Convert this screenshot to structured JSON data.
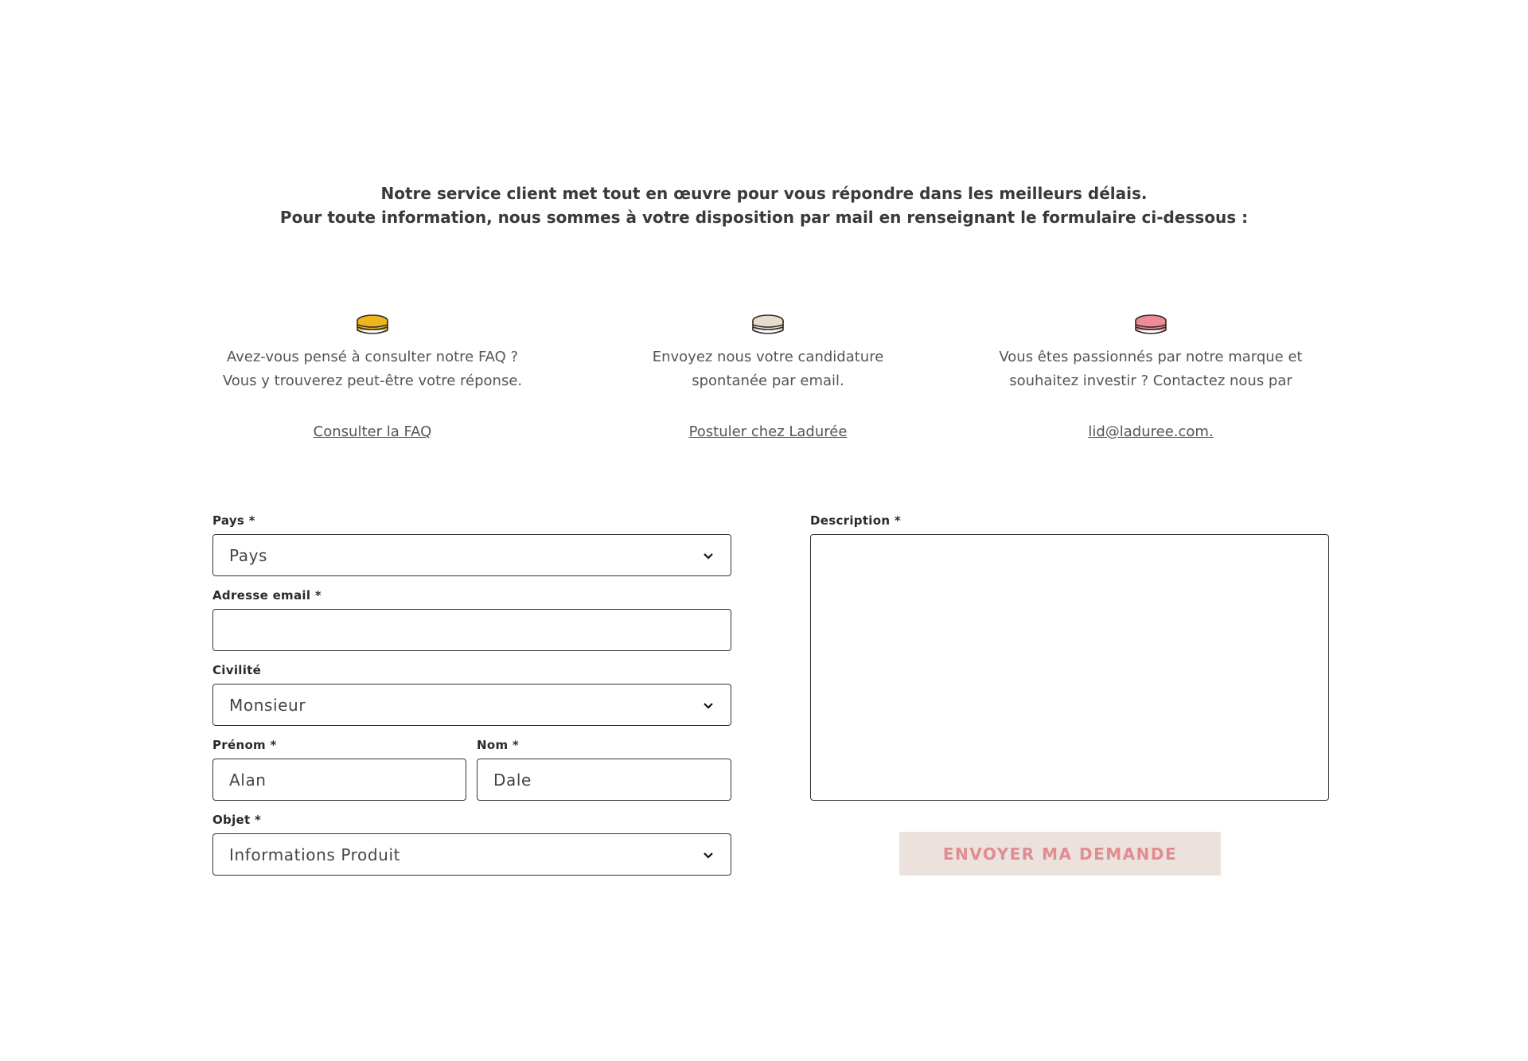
{
  "intro": {
    "line1": "Notre service client met tout en œuvre pour vous répondre dans les meilleurs délais.",
    "line2": "Pour toute information, nous sommes à votre disposition par mail en renseignant le formulaire ci-dessous :"
  },
  "info_columns": [
    {
      "icon": "macaron-yellow-icon",
      "color": "#f0b41c",
      "line1": "Avez-vous pensé à consulter notre FAQ ?",
      "line2": "Vous y trouverez peut-être votre réponse.",
      "link": "Consulter la FAQ"
    },
    {
      "icon": "macaron-beige-icon",
      "color": "#eadccc",
      "line1": "Envoyez nous votre candidature",
      "line2": "spontanée par email.",
      "link": "Postuler chez Ladurée"
    },
    {
      "icon": "macaron-pink-icon",
      "color": "#f08a96",
      "line1": "Vous êtes passionnés par notre marque et",
      "line2": "souhaitez investir ? Contactez nous par",
      "link": "lid@laduree.com."
    }
  ],
  "form": {
    "pays": {
      "label": "Pays *",
      "value": "Pays"
    },
    "email": {
      "label": "Adresse email *",
      "value": ""
    },
    "civilite": {
      "label": "Civilité",
      "value": "Monsieur"
    },
    "prenom": {
      "label": "Prénom *",
      "value": "Alan"
    },
    "nom": {
      "label": "Nom *",
      "value": "Dale"
    },
    "objet": {
      "label": "Objet *",
      "value": "Informations Produit"
    },
    "description": {
      "label": "Description *",
      "value": ""
    },
    "submit_label": "ENVOYER MA DEMANDE"
  }
}
